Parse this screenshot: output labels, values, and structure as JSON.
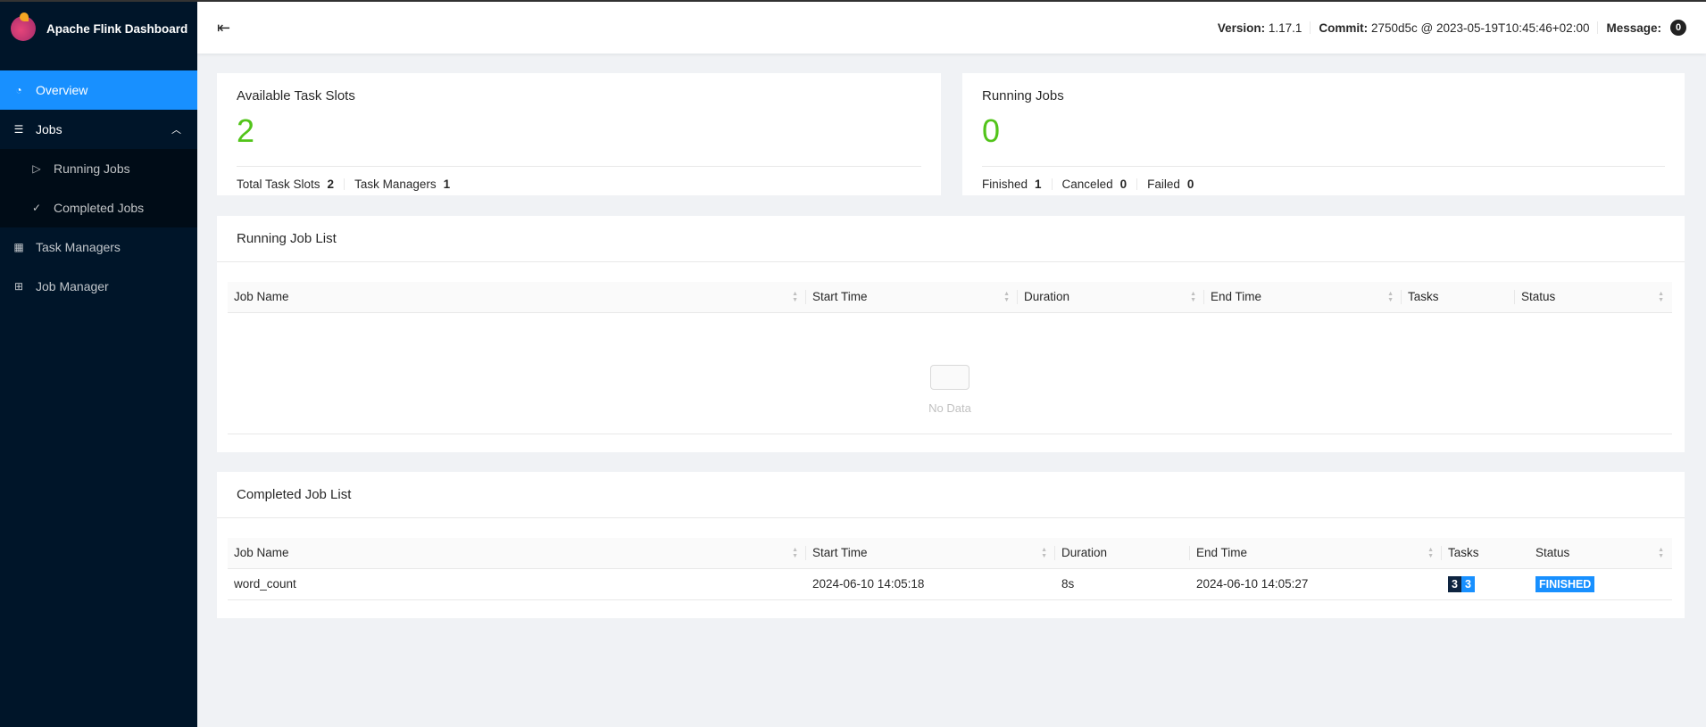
{
  "app": {
    "title": "Apache Flink Dashboard"
  },
  "sidebar": {
    "items": [
      {
        "label": "Overview",
        "icon": "dashboard-icon"
      },
      {
        "label": "Jobs",
        "icon": "list-icon"
      },
      {
        "label": "Running Jobs",
        "icon": "play-circle-icon"
      },
      {
        "label": "Completed Jobs",
        "icon": "check-circle-icon"
      },
      {
        "label": "Task Managers",
        "icon": "schedule-icon"
      },
      {
        "label": "Job Manager",
        "icon": "cluster-icon"
      }
    ]
  },
  "header": {
    "version_label": "Version:",
    "version": "1.17.1",
    "commit_label": "Commit:",
    "commit": "2750d5c @ 2023-05-19T10:45:46+02:00",
    "message_label": "Message:",
    "message_count": "0"
  },
  "slots": {
    "title": "Available Task Slots",
    "value": "2",
    "total_label": "Total Task Slots",
    "total": "2",
    "tm_label": "Task Managers",
    "tm": "1"
  },
  "running": {
    "title": "Running Jobs",
    "value": "0",
    "finished_label": "Finished",
    "finished": "1",
    "canceled_label": "Canceled",
    "canceled": "0",
    "failed_label": "Failed",
    "failed": "0"
  },
  "running_list": {
    "title": "Running Job List",
    "columns": [
      "Job Name",
      "Start Time",
      "Duration",
      "End Time",
      "Tasks",
      "Status"
    ],
    "empty": "No Data"
  },
  "completed_list": {
    "title": "Completed Job List",
    "columns": [
      "Job Name",
      "Start Time",
      "Duration",
      "End Time",
      "Tasks",
      "Status"
    ],
    "rows": [
      {
        "name": "word_count",
        "start": "2024-06-10 14:05:18",
        "duration": "8s",
        "end": "2024-06-10 14:05:27",
        "tasks_a": "3",
        "tasks_b": "3",
        "status": "FINISHED"
      }
    ]
  },
  "colors": {
    "accent": "#1890ff",
    "green": "#52c41a",
    "sidebar": "#001529"
  }
}
